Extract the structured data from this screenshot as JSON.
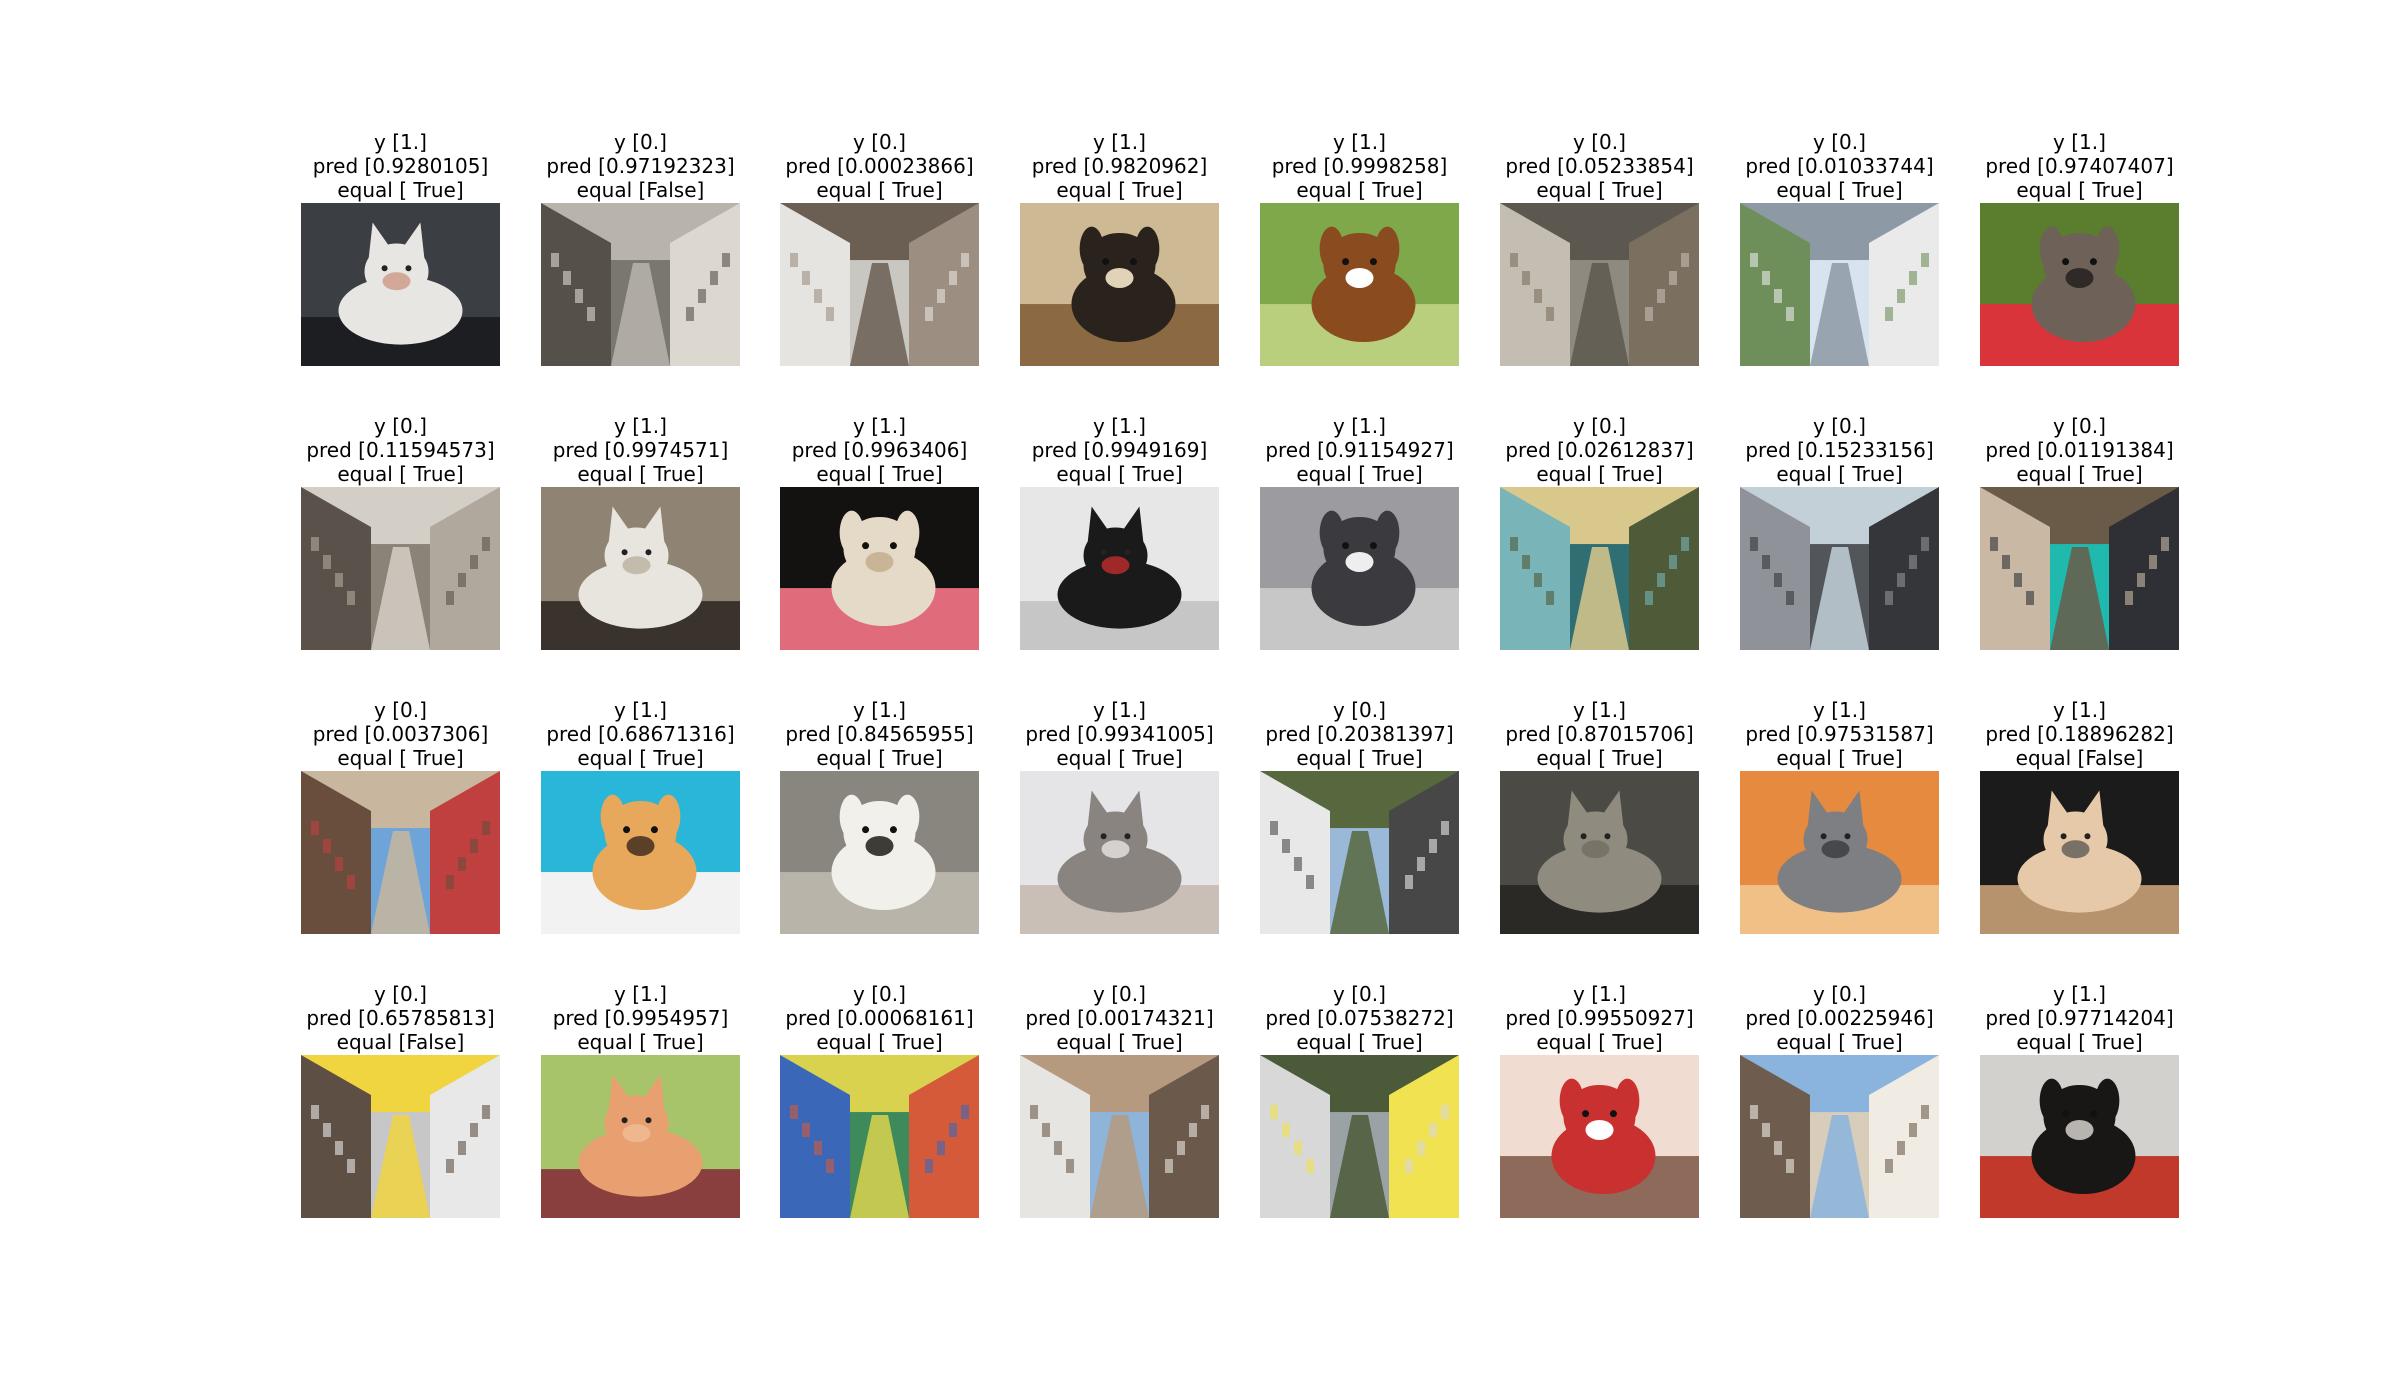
{
  "figure": {
    "panels": [
      {
        "y": "y [1.]",
        "pred": "pred [0.9280105]",
        "equal": "equal [ True]",
        "subject": "cat"
      },
      {
        "y": "y [0.]",
        "pred": "pred [0.97192323]",
        "equal": "equal [False]",
        "subject": "alley"
      },
      {
        "y": "y [0.]",
        "pred": "pred [0.00023866]",
        "equal": "equal [ True]",
        "subject": "street"
      },
      {
        "y": "y [1.]",
        "pred": "pred [0.9820962]",
        "equal": "equal [ True]",
        "subject": "dog"
      },
      {
        "y": "y [1.]",
        "pred": "pred [0.9998258]",
        "equal": "equal [ True]",
        "subject": "dog"
      },
      {
        "y": "y [0.]",
        "pred": "pred [0.05233854]",
        "equal": "equal [ True]",
        "subject": "alley"
      },
      {
        "y": "y [0.]",
        "pred": "pred [0.01033744]",
        "equal": "equal [ True]",
        "subject": "street"
      },
      {
        "y": "y [1.]",
        "pred": "pred [0.97407407]",
        "equal": "equal [ True]",
        "subject": "dog"
      },
      {
        "y": "y [0.]",
        "pred": "pred [0.11594573]",
        "equal": "equal [ True]",
        "subject": "street"
      },
      {
        "y": "y [1.]",
        "pred": "pred [0.9974571]",
        "equal": "equal [ True]",
        "subject": "cat"
      },
      {
        "y": "y [1.]",
        "pred": "pred [0.9963406]",
        "equal": "equal [ True]",
        "subject": "dog"
      },
      {
        "y": "y [1.]",
        "pred": "pred [0.9949169]",
        "equal": "equal [ True]",
        "subject": "cat"
      },
      {
        "y": "y [1.]",
        "pred": "pred [0.91154927]",
        "equal": "equal [ True]",
        "subject": "dog"
      },
      {
        "y": "y [0.]",
        "pred": "pred [0.02612837]",
        "equal": "equal [ True]",
        "subject": "alley"
      },
      {
        "y": "y [0.]",
        "pred": "pred [0.15233156]",
        "equal": "equal [ True]",
        "subject": "alley"
      },
      {
        "y": "y [0.]",
        "pred": "pred [0.01191384]",
        "equal": "equal [ True]",
        "subject": "alley"
      },
      {
        "y": "y [0.]",
        "pred": "pred [0.0037306]",
        "equal": "equal [ True]",
        "subject": "street"
      },
      {
        "y": "y [1.]",
        "pred": "pred [0.68671316]",
        "equal": "equal [ True]",
        "subject": "dog"
      },
      {
        "y": "y [1.]",
        "pred": "pred [0.84565955]",
        "equal": "equal [ True]",
        "subject": "dog"
      },
      {
        "y": "y [1.]",
        "pred": "pred [0.99341005]",
        "equal": "equal [ True]",
        "subject": "cat"
      },
      {
        "y": "y [0.]",
        "pred": "pred [0.20381397]",
        "equal": "equal [ True]",
        "subject": "alley"
      },
      {
        "y": "y [1.]",
        "pred": "pred [0.87015706]",
        "equal": "equal [ True]",
        "subject": "cat"
      },
      {
        "y": "y [1.]",
        "pred": "pred [0.97531587]",
        "equal": "equal [ True]",
        "subject": "cat"
      },
      {
        "y": "y [1.]",
        "pred": "pred [0.18896282]",
        "equal": "equal [False]",
        "subject": "cat"
      },
      {
        "y": "y [0.]",
        "pred": "pred [0.65785813]",
        "equal": "equal [False]",
        "subject": "alley"
      },
      {
        "y": "y [1.]",
        "pred": "pred [0.9954957]",
        "equal": "equal [ True]",
        "subject": "cat"
      },
      {
        "y": "y [0.]",
        "pred": "pred [0.00068161]",
        "equal": "equal [ True]",
        "subject": "alley"
      },
      {
        "y": "y [0.]",
        "pred": "pred [0.00174321]",
        "equal": "equal [ True]",
        "subject": "street"
      },
      {
        "y": "y [0.]",
        "pred": "pred [0.07538272]",
        "equal": "equal [ True]",
        "subject": "street"
      },
      {
        "y": "y [1.]",
        "pred": "pred [0.99550927]",
        "equal": "equal [ True]",
        "subject": "dog"
      },
      {
        "y": "y [0.]",
        "pred": "pred [0.00225946]",
        "equal": "equal [ True]",
        "subject": "alley"
      },
      {
        "y": "y [1.]",
        "pred": "pred [0.97714204]",
        "equal": "equal [ True]",
        "subject": "dog"
      }
    ],
    "palettes": [
      [
        "#3b3f44",
        "#e8e6e2",
        "#1d1e22",
        "#c98f7a"
      ],
      [
        "#7a7670",
        "#b9b4ab",
        "#55504a",
        "#dcd8d0"
      ],
      [
        "#c9c7c2",
        "#6b5e52",
        "#e6e4e0",
        "#9c8f82"
      ],
      [
        "#cdb993",
        "#2a221c",
        "#e0d3b8",
        "#8b6a43"
      ],
      [
        "#7ea84a",
        "#8a4b1f",
        "#ffffff",
        "#b9cf7d"
      ],
      [
        "#8f8a80",
        "#5d584f",
        "#c4bdb2",
        "#7b6f5f"
      ],
      [
        "#d7e3ee",
        "#8d9aa6",
        "#6e8f5a",
        "#eaeaea"
      ],
      [
        "#5a7d2e",
        "#6e6258",
        "#2f2a27",
        "#d8343a"
      ],
      [
        "#8b8378",
        "#d4cfc6",
        "#5a514a",
        "#b0a89c"
      ],
      [
        "#8f8474",
        "#e8e4de",
        "#3a322c",
        "#b4a996"
      ],
      [
        "#141210",
        "#e5dac7",
        "#c9b496",
        "#e06b7a"
      ],
      [
        "#e7e7e7",
        "#1a1a1a",
        "#c6c6c6",
        "#d93131"
      ],
      [
        "#9b9ba0",
        "#3b3b3f",
        "#eeeeee",
        "#c7c7c7"
      ],
      [
        "#2f6e73",
        "#d8c88c",
        "#78b4b8",
        "#4e5a38"
      ],
      [
        "#52565b",
        "#c3d0d8",
        "#8f9399",
        "#343639"
      ],
      [
        "#1fb9ad",
        "#6a5a48",
        "#c9b9a4",
        "#2e3036"
      ],
      [
        "#6fa4d8",
        "#c8b79e",
        "#6a4e3d",
        "#c04040"
      ],
      [
        "#2ab6d8",
        "#e7a85b",
        "#5b4029",
        "#f2f2f2"
      ],
      [
        "#898680",
        "#f2f0ea",
        "#3f3b36",
        "#b9b4aa"
      ],
      [
        "#e5e5e8",
        "#8a8481",
        "#c9bfb6",
        "#f5f2ef"
      ],
      [
        "#9ab9d8",
        "#57683f",
        "#e8e8e8",
        "#474747"
      ],
      [
        "#4b4a45",
        "#8f8b7f",
        "#2a2926",
        "#6e6a5d"
      ],
      [
        "#e58a3f",
        "#7d7f82",
        "#f0c087",
        "#2f3136"
      ],
      [
        "#1b1b1b",
        "#e6c9a8",
        "#b6926d",
        "#4a4a4a"
      ],
      [
        "#c7c7c7",
        "#f0d440",
        "#5d4f44",
        "#e8e8e8"
      ],
      [
        "#a7c46a",
        "#e8a070",
        "#8a3f3f",
        "#f2c09a"
      ],
      [
        "#3f8a5a",
        "#d9d24f",
        "#3a67b8",
        "#d45a3a"
      ],
      [
        "#8fb4d9",
        "#b69a7f",
        "#e7e5e1",
        "#6b5a4c"
      ],
      [
        "#9aa2a5",
        "#4b5a38",
        "#d8d8d8",
        "#f0e250"
      ],
      [
        "#f0dcd0",
        "#c93030",
        "#ffffff",
        "#8e6a5a"
      ],
      [
        "#d8ccba",
        "#8ab4dd",
        "#6e5d4e",
        "#f0ece4"
      ],
      [
        "#d3d1ce",
        "#181716",
        "#b8b5b0",
        "#c0392b"
      ]
    ]
  }
}
